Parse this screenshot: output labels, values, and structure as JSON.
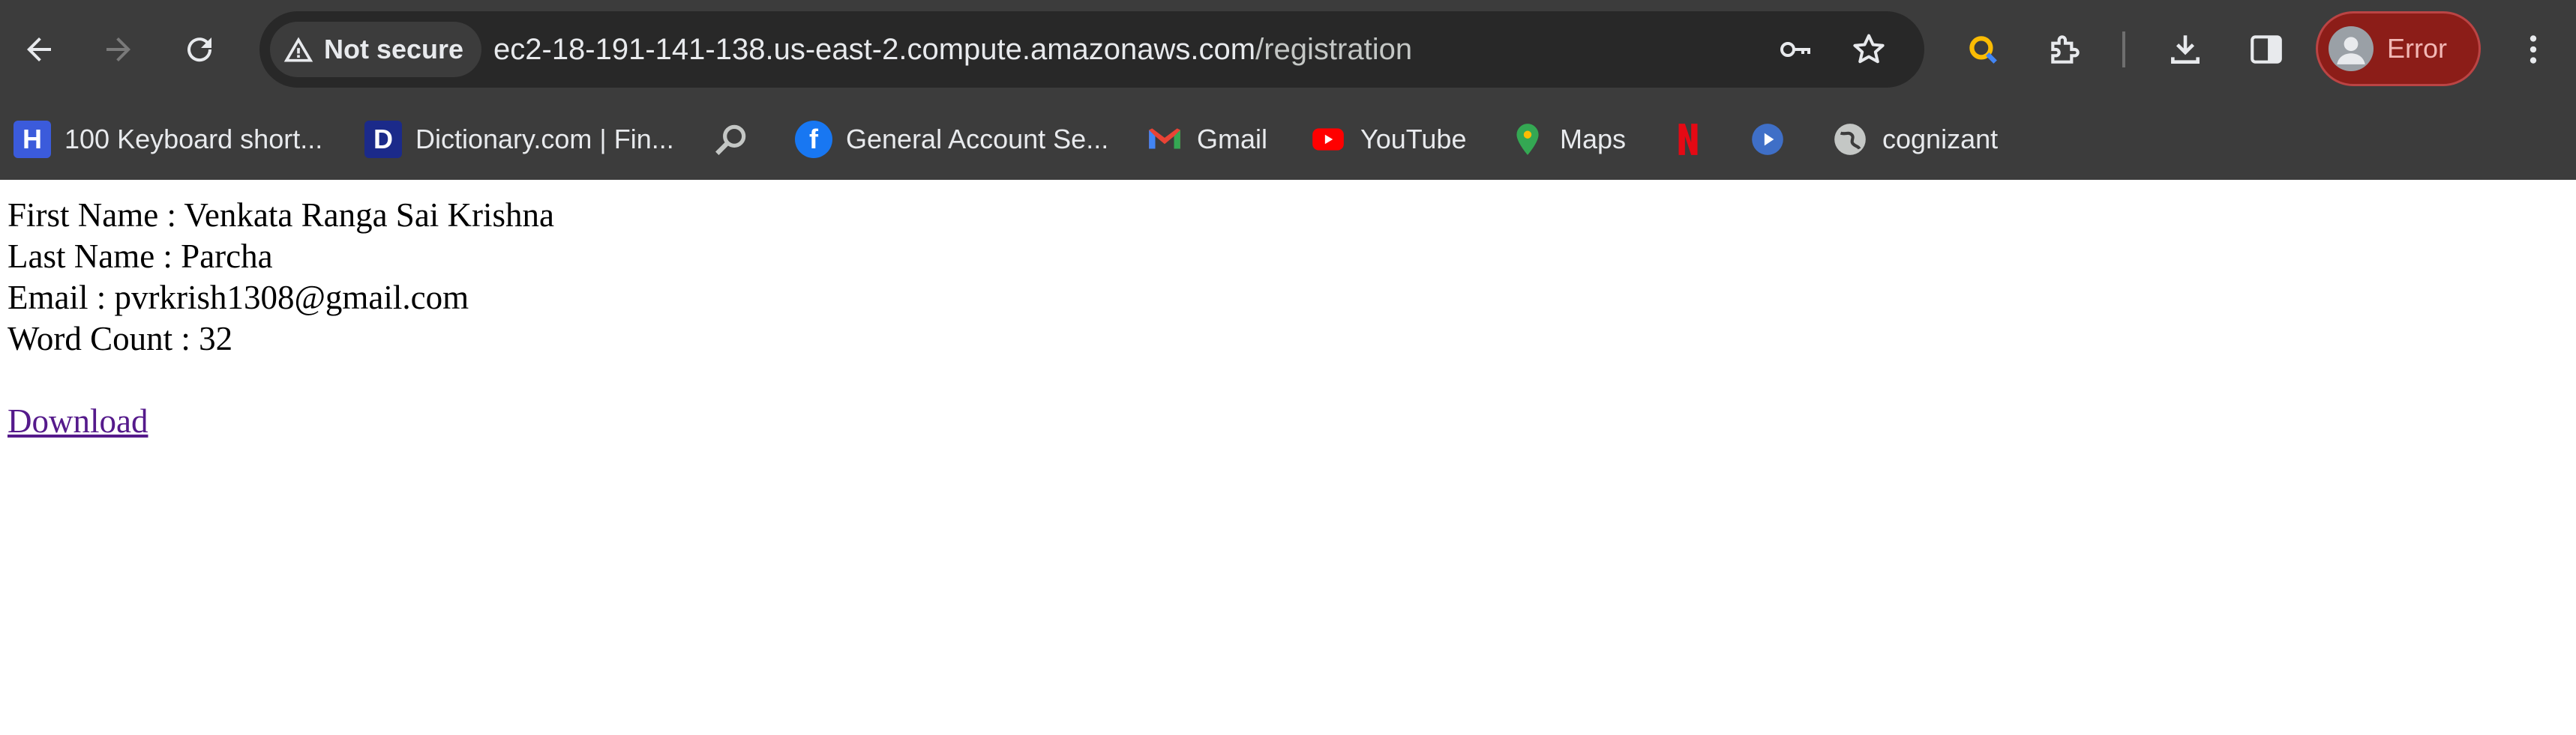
{
  "browser": {
    "security_label": "Not secure",
    "url_host": "ec2-18-191-141-138.us-east-2.compute.amazonaws.com",
    "url_path": "/registration",
    "profile_label": "Error",
    "icons": {
      "back": "arrow-left-icon",
      "forward": "arrow-right-icon",
      "reload": "reload-icon",
      "warning": "warning-triangle-icon",
      "key": "key-icon",
      "bookmark": "star-icon",
      "lens": "lens-icon",
      "extensions": "puzzle-icon",
      "download": "download-icon",
      "sidepanel": "side-panel-icon",
      "menu": "kebab-menu-icon"
    }
  },
  "bookmarks": [
    {
      "label": "100 Keyboard short...",
      "icon": "h-favicon",
      "color": "#3b5bdb"
    },
    {
      "label": "Dictionary.com | Fin...",
      "icon": "d-favicon",
      "color": "#1b2a8a"
    },
    {
      "label": "",
      "icon": "magnifier-favicon",
      "color": "#9aa0a6"
    },
    {
      "label": "General Account Se...",
      "icon": "facebook-favicon",
      "color": "#1877f2"
    },
    {
      "label": "Gmail",
      "icon": "gmail-favicon",
      "color": "#ea4335"
    },
    {
      "label": "YouTube",
      "icon": "youtube-favicon",
      "color": "#ff0000"
    },
    {
      "label": "Maps",
      "icon": "maps-pin-favicon",
      "color": "#34a853"
    },
    {
      "label": "",
      "icon": "netflix-favicon",
      "color": "#e50914"
    },
    {
      "label": "",
      "icon": "play-favicon",
      "color": "#3f6fc7"
    },
    {
      "label": "cognizant",
      "icon": "globe-favicon",
      "color": "#c4c7c5"
    }
  ],
  "page": {
    "first_name": "First Name : Venkata Ranga Sai Krishna",
    "last_name": "Last Name : Parcha",
    "email": "Email : pvrkrish1308@gmail.com",
    "word_count": "Word Count : 32",
    "download_link": "Download"
  }
}
